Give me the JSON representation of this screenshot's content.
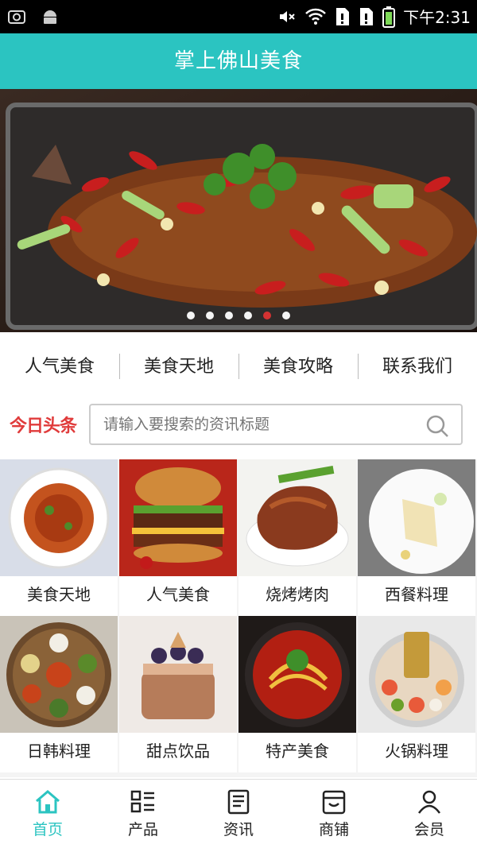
{
  "status_bar": {
    "time": "下午2:31",
    "icons": [
      "screenshot-icon",
      "android-icon",
      "mute-icon",
      "wifi-icon",
      "sim1-icon",
      "sim2-icon",
      "battery-icon"
    ]
  },
  "header": {
    "title": "掌上佛山美食"
  },
  "banner": {
    "slide_count": 6,
    "active_index": 4
  },
  "nav": {
    "items": [
      {
        "label": "人气美食"
      },
      {
        "label": "美食天地"
      },
      {
        "label": "美食攻略"
      },
      {
        "label": "联系我们"
      }
    ]
  },
  "search": {
    "logo_text": "今日头条",
    "placeholder": "请输入要搜索的资讯标题"
  },
  "categories": [
    {
      "label": "美食天地"
    },
    {
      "label": "人气美食"
    },
    {
      "label": "烧烤烤肉"
    },
    {
      "label": "西餐料理"
    },
    {
      "label": "日韩料理"
    },
    {
      "label": "甜点饮品"
    },
    {
      "label": "特产美食"
    },
    {
      "label": "火锅料理"
    }
  ],
  "tabs": [
    {
      "label": "首页",
      "icon": "home-icon",
      "active": true
    },
    {
      "label": "产品",
      "icon": "grid-list-icon",
      "active": false
    },
    {
      "label": "资讯",
      "icon": "news-icon",
      "active": false
    },
    {
      "label": "商铺",
      "icon": "store-icon",
      "active": false
    },
    {
      "label": "会员",
      "icon": "user-icon",
      "active": false
    }
  ],
  "colors": {
    "accent": "#2bc4c1",
    "logo": "#e03b3b"
  }
}
